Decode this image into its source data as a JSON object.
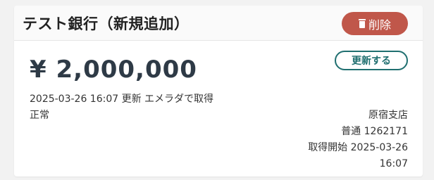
{
  "account": {
    "title": "テスト銀行（新規追加）",
    "delete_label": "削除",
    "amount": "¥ 2,000,000",
    "update_label": "更新する",
    "updated_text": "2025-03-26 16:07 更新 エメラダで取得",
    "status": "正常",
    "branch": "原宿支店",
    "account_number": "普通 1262171",
    "acquisition_start": "取得開始 2025-03-26",
    "acquisition_time": "16:07"
  },
  "colors": {
    "delete": "#c0574a",
    "update_border": "#1f6f70",
    "amount_text": "#2e3a46"
  },
  "icons": {
    "delete": "trash-icon"
  }
}
